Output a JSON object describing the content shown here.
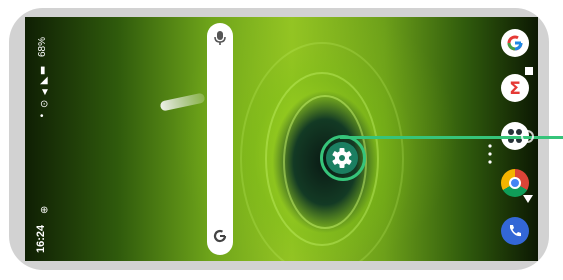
{
  "status_bar": {
    "battery": "68%",
    "time": "16:24"
  },
  "search_bar": {
    "mic_icon": "mic-icon",
    "assistant_icon": "google-g-icon"
  },
  "highlight": {
    "icon": "settings-gear-icon",
    "ring_color": "#36c47a"
  },
  "dock": {
    "apps": [
      {
        "name": "google-app-icon"
      },
      {
        "name": "sigma-app-icon"
      },
      {
        "name": "app-drawer-icon"
      },
      {
        "name": "chrome-icon"
      },
      {
        "name": "phone-icon"
      }
    ]
  },
  "nav_bar": {
    "recents": "recents-button",
    "home": "home-button",
    "back": "back-button"
  }
}
